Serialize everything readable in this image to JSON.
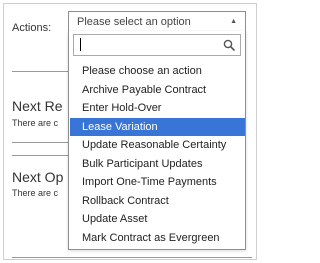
{
  "form": {
    "actions_label": "Actions:"
  },
  "select": {
    "placeholder": "Please select an option",
    "search_value": "",
    "options": [
      "Please choose an action",
      "Archive Payable Contract",
      "Enter Hold-Over",
      "Lease Variation",
      "Update Reasonable Certainty",
      "Bulk Participant Updates",
      "Import One-Time Payments",
      "Rollback Contract",
      "Update Asset",
      "Mark Contract as Evergreen"
    ],
    "highlighted_index": 3
  },
  "background_sections": [
    {
      "title": "Next Re",
      "text": "There are c"
    },
    {
      "title": "Next Op",
      "text": "There are c"
    }
  ],
  "colors": {
    "highlight": "#3875d7",
    "highlight_text": "#ffffff"
  }
}
